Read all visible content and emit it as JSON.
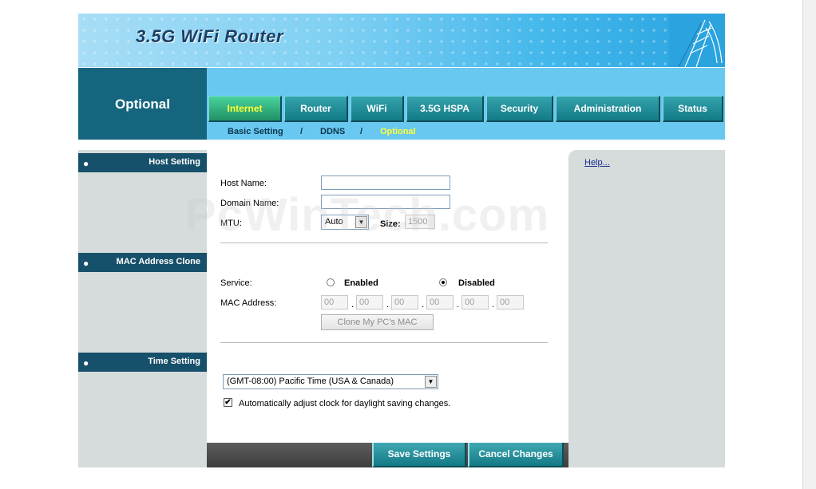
{
  "header": {
    "title": "3.5G WiFi Router"
  },
  "section": {
    "title": "Optional"
  },
  "tabs": [
    {
      "label": "Internet",
      "active": true
    },
    {
      "label": "Router",
      "active": false
    },
    {
      "label": "WiFi",
      "active": false
    },
    {
      "label": "3.5G HSPA",
      "active": false
    },
    {
      "label": "Security",
      "active": false
    },
    {
      "label": "Administration",
      "active": false
    },
    {
      "label": "Status",
      "active": false
    }
  ],
  "subnav": {
    "items": [
      "Basic Setting",
      "DDNS",
      "Optional"
    ],
    "separator": "/",
    "active": "Optional"
  },
  "left_headers": [
    "Host Setting",
    "MAC Address Clone",
    "Time Setting"
  ],
  "host_setting": {
    "host_name_label": "Host Name:",
    "host_name_value": "",
    "domain_name_label": "Domain Name:",
    "domain_name_value": "",
    "mtu_label": "MTU:",
    "mtu_value": "Auto",
    "size_label": "Size:",
    "size_value": "1500"
  },
  "mac_clone": {
    "service_label": "Service:",
    "enabled_label": "Enabled",
    "disabled_label": "Disabled",
    "selected": "Disabled",
    "mac_label": "MAC Address:",
    "mac_octets": [
      "00",
      "00",
      "00",
      "00",
      "00",
      "00"
    ],
    "clone_button": "Clone My PC's MAC"
  },
  "time_setting": {
    "timezone": "(GMT-08:00) Pacific Time (USA & Canada)",
    "dst_label": "Automatically adjust clock for daylight saving changes.",
    "dst_checked": true,
    "check_glyph": "✔"
  },
  "help": {
    "link": "Help..."
  },
  "actions": {
    "save": "Save Settings",
    "cancel": "Cancel Changes"
  },
  "watermark": "PcWinTech.com",
  "colors": {
    "dark_teal": "#16657e",
    "sky": "#69c8f0",
    "active_tab_text": "#ffff33",
    "panel_gray": "#d6dbdb"
  }
}
